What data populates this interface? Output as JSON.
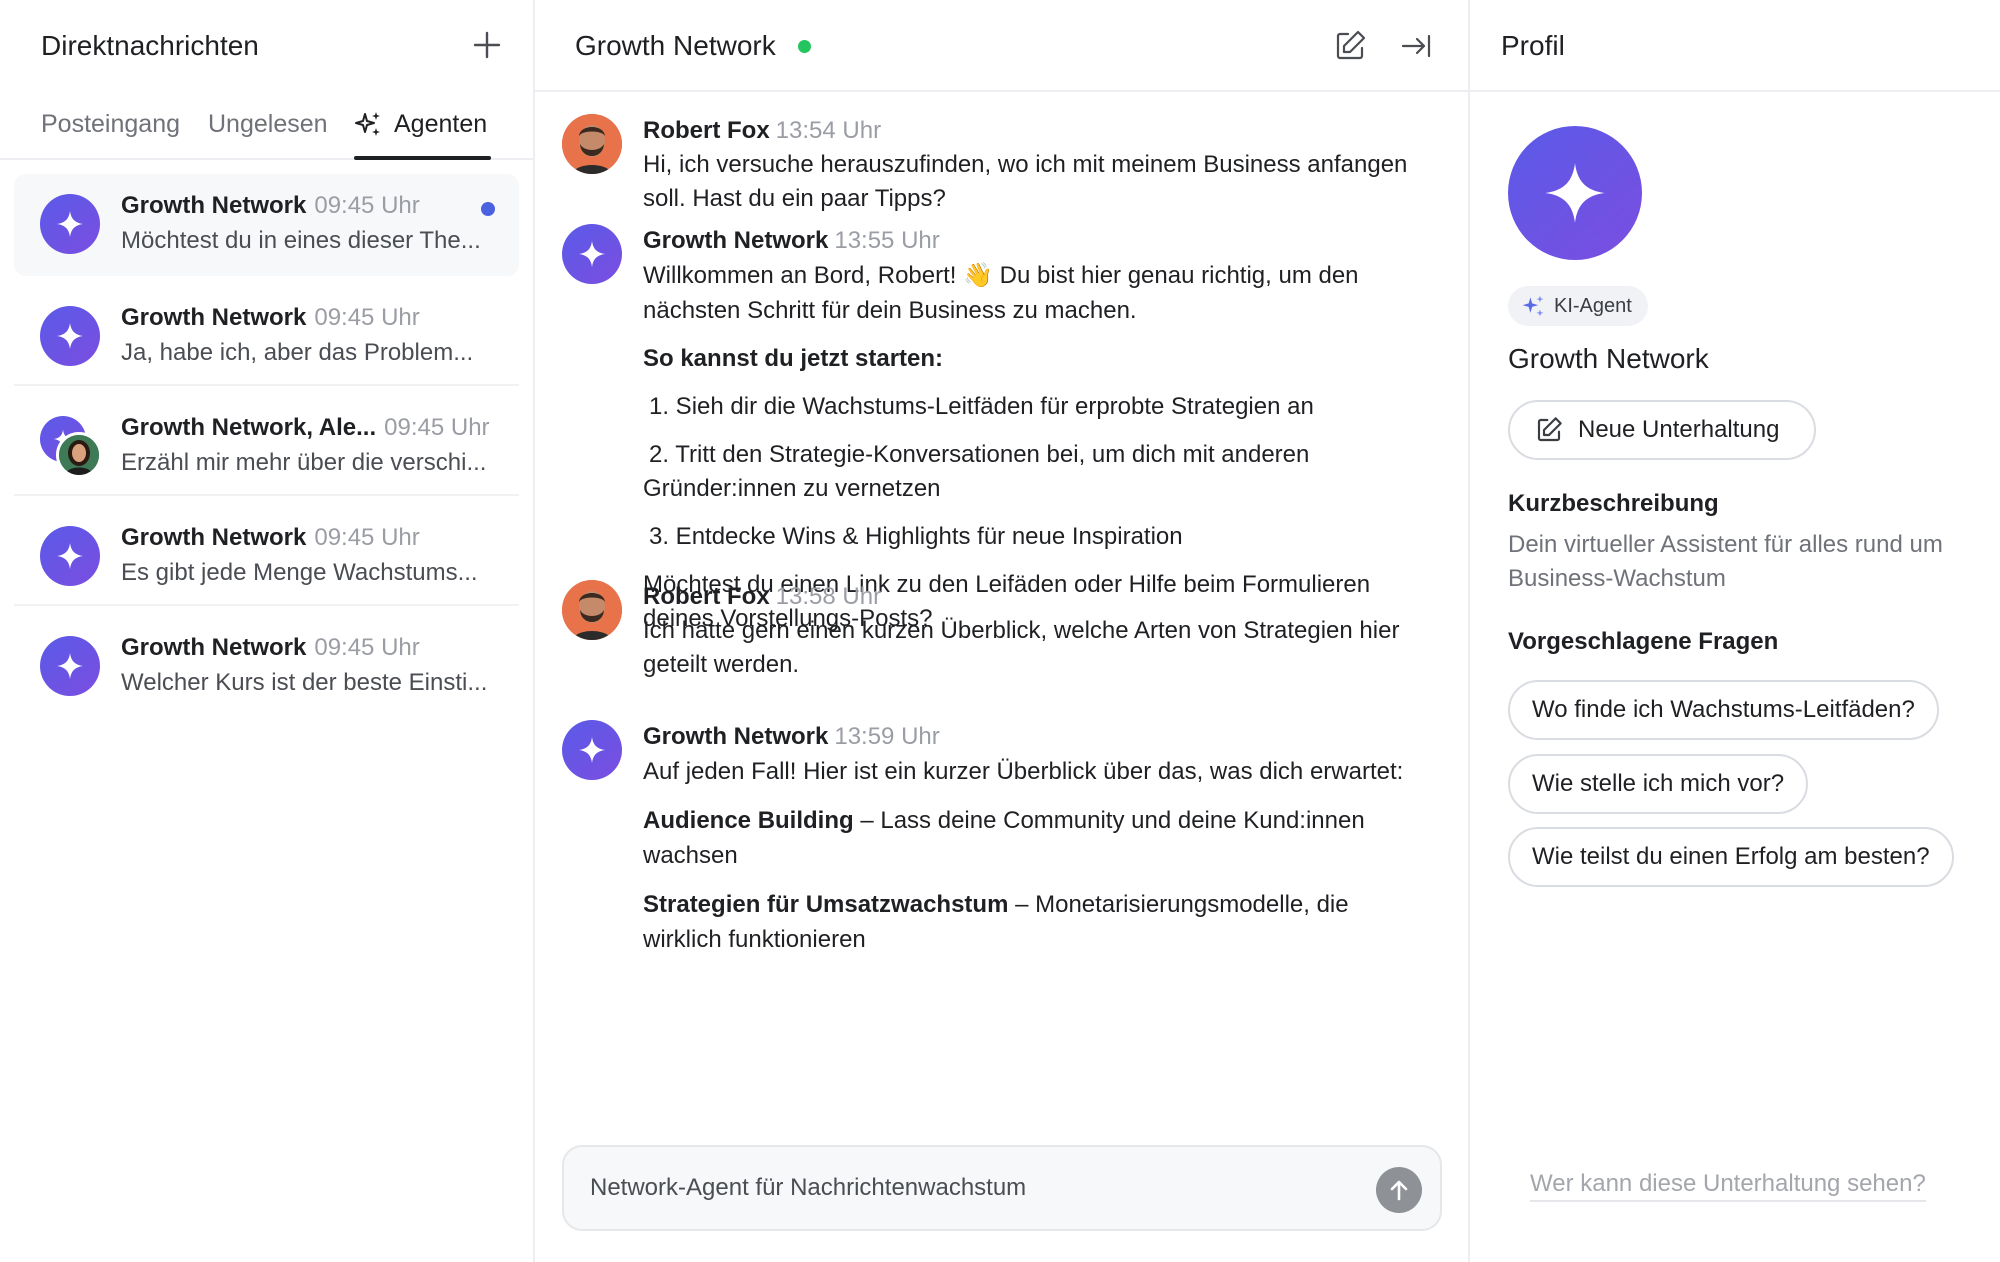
{
  "left": {
    "title": "Direktnachrichten",
    "tabs": [
      "Posteingang",
      "Ungelesen",
      "Agenten"
    ],
    "conversations": [
      {
        "name": "Growth Network",
        "time": "09:45 Uhr",
        "preview": "Möchtest du in eines dieser The...",
        "unread": true,
        "type": "agent"
      },
      {
        "name": "Growth Network",
        "time": "09:45 Uhr",
        "preview": "Ja, habe ich, aber das Problem...",
        "unread": false,
        "type": "agent"
      },
      {
        "name": "Growth Network, Ale...",
        "time": "09:45 Uhr",
        "preview": "Erzähl mir mehr über die verschi...",
        "unread": false,
        "type": "group"
      },
      {
        "name": "Growth Network",
        "time": "09:45 Uhr",
        "preview": "Es gibt jede Menge Wachstums...",
        "unread": false,
        "type": "agent"
      },
      {
        "name": "Growth Network",
        "time": "09:45 Uhr",
        "preview": "Welcher Kurs ist der beste Einsti...",
        "unread": false,
        "type": "agent"
      }
    ]
  },
  "chat": {
    "title": "Growth Network",
    "messages": [
      {
        "author": "Robert Fox",
        "time": "13:54 Uhr",
        "text": "Hi, ich versuche herauszufinden, wo ich mit meinem Business anfangen soll. Hast du ein paar Tipps?"
      },
      {
        "author": "Growth Network",
        "time": "13:55 Uhr",
        "intro": "Willkommen an Bord, Robert! 👋 Du bist hier genau richtig, um den nächsten Schritt für dein Business zu machen.",
        "heading": "So kannst du jetzt starten:",
        "steps": [
          "1. Sieh dir die Wachstums-Leitfäden für erprobte Strategien an",
          "2. Tritt den Strategie-Konversationen bei, um dich mit anderen Gründer:innen zu vernetzen",
          "3. Entdecke Wins & Highlights für neue Inspiration"
        ],
        "outro": "Möchtest du einen Link zu den Leifäden oder Hilfe beim Formulieren deines Vorstellungs-Posts?"
      },
      {
        "author": "Robert Fox",
        "time": "13:58 Uhr",
        "text": "Ich hätte gern einen kurzen Überblick, welche Arten von Strategien hier geteilt werden."
      },
      {
        "author": "Growth Network",
        "time": "13:59 Uhr",
        "intro": "Auf jeden Fall! Hier ist ein kurzer Überblick über das, was dich erwartet:",
        "items": [
          {
            "bold": "Audience Building",
            "rest": " – Lass deine Community und deine Kund:innen wachsen"
          },
          {
            "bold": "Strategien für Umsatzwachstum",
            "rest": " – Monetarisierungsmodelle, die wirklich funktionieren"
          }
        ]
      }
    ],
    "composer_placeholder": "Network-Agent für Nachrichtenwachstum"
  },
  "profile": {
    "title": "Profil",
    "badge": "KI-Agent",
    "name": "Growth Network",
    "new_conversation": "Neue Unterhaltung",
    "short_desc_heading": "Kurzbeschreibung",
    "short_desc": "Dein virtueller Assistent für alles rund um Business-Wachstum",
    "suggested_heading": "Vorgeschlagene Fragen",
    "suggested": [
      "Wo finde ich Wachstums-Leitfäden?",
      "Wie stelle ich mich vor?",
      "Wie teilst du einen Erfolg am besten?"
    ],
    "visibility_link": "Wer kann diese Unterhaltung sehen?"
  },
  "colors": {
    "accent": "#5a5ae8",
    "online": "#22c55e",
    "unread": "#4a62e0"
  },
  "icons": [
    "plus-icon",
    "sparkle-icon",
    "edit-icon",
    "collapse-panel-icon",
    "send-arrow-icon"
  ]
}
